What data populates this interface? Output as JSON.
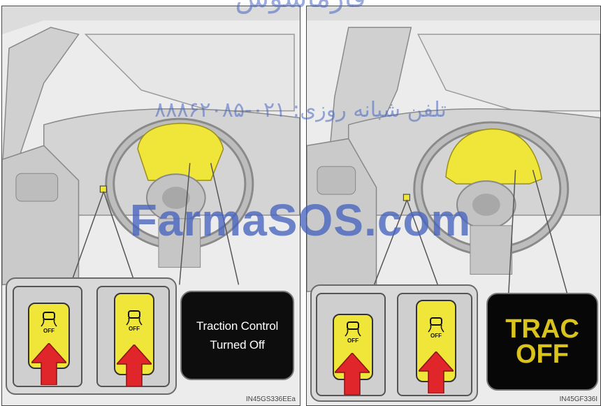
{
  "panels": {
    "left": {
      "message_lines": [
        "Traction Control",
        "Turned Off"
      ],
      "button_labels": [
        "OFF",
        "OFF"
      ],
      "code": "IN45GS336EEa"
    },
    "right": {
      "message_lines": [
        "TRAC",
        "OFF"
      ],
      "button_labels": [
        "OFF",
        "OFF"
      ],
      "code": "IN45GF336I"
    }
  },
  "watermark": {
    "phone": "تلفن شبانه روزی: ۰۲۱-۸۸۸۶۲۰۸۵",
    "url": "FarmaSOS.com",
    "top_text": "فارماسوس"
  },
  "colors": {
    "highlight_yellow": "#f0e63a",
    "arrow_red": "#e0262b",
    "screen_black": "#0d0d0d",
    "trac_amber": "#d9c31c",
    "watermark_blue": "#4664be"
  }
}
